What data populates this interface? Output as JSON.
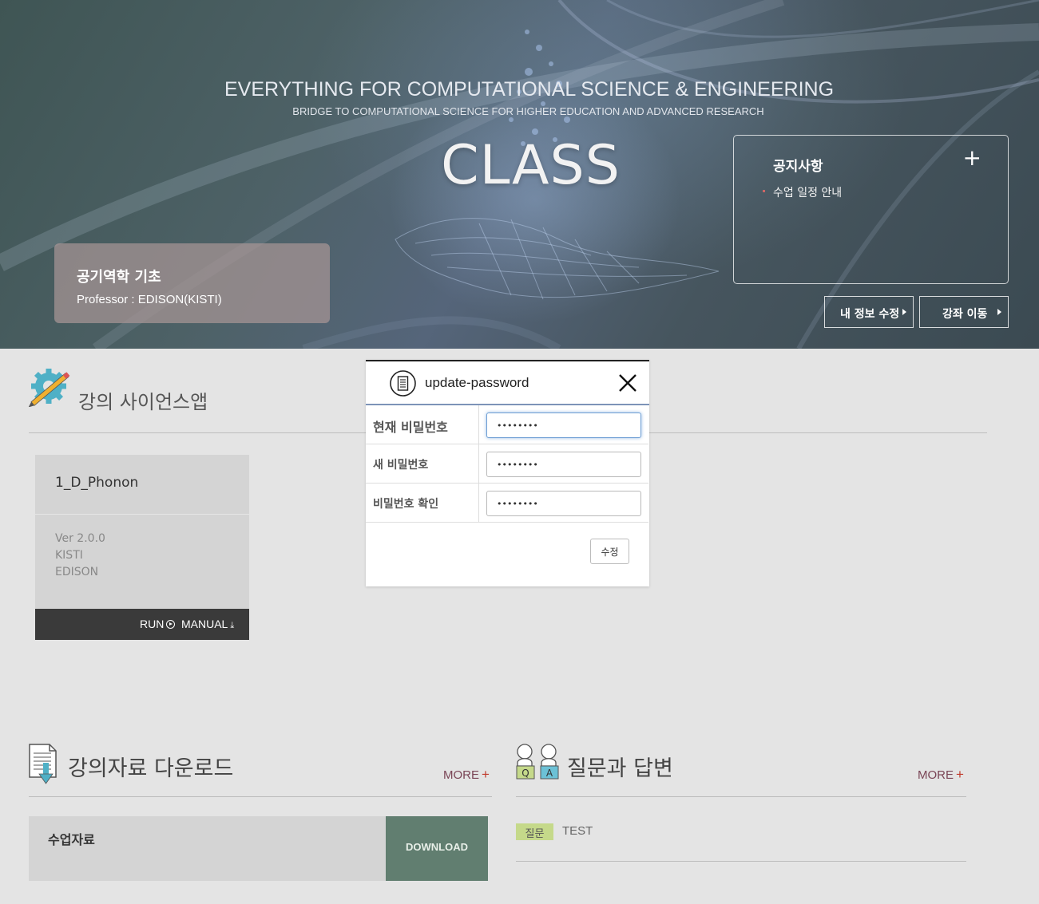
{
  "hero": {
    "headline": "EVERYTHING FOR COMPUTATIONAL SCIENCE & ENGINEERING",
    "subheadline": "BRIDGE TO COMPUTATIONAL SCIENCE FOR HIGHER EDUCATION AND ADVANCED RESEARCH",
    "class_label": "CLASS"
  },
  "course": {
    "title": "공기역학 기초",
    "professor": "Professor : EDISON(KISTI)"
  },
  "notice": {
    "title": "공지사항",
    "plus_icon": "plus-icon",
    "items": [
      "수업 일정 안내"
    ]
  },
  "buttons": {
    "my_info": "내 정보 수정",
    "move_course": "강좌 이동"
  },
  "science_apps": {
    "title": "강의 사이언스앱",
    "icon": "gear-pencil-icon",
    "apps": [
      {
        "name": "1_D_Phonon",
        "version": "Ver 2.0.0",
        "org": "KISTI",
        "author": "EDISON",
        "run_label": "RUN",
        "manual_label": "MANUAL"
      }
    ]
  },
  "downloads": {
    "title": "강의자료 다운로드",
    "more": "MORE",
    "items": [
      {
        "name": "수업자료",
        "action": "DOWNLOAD"
      }
    ]
  },
  "qa": {
    "title": "질문과 답변",
    "more": "MORE",
    "items": [
      {
        "badge": "질문",
        "text": "TEST"
      }
    ]
  },
  "modal": {
    "title": "update-password",
    "fields": [
      {
        "label": "현재 비밀번호",
        "value": "••••••••"
      },
      {
        "label": "새 비밀번호",
        "value": "••••••••"
      },
      {
        "label": "비밀번호 확인",
        "value": "••••••••"
      }
    ],
    "submit": "수정"
  },
  "colors": {
    "download_bg": "#617e70",
    "qa_badge_bg": "#c5d98a",
    "more_link": "#7a4556",
    "modal_accent": "#7d93b8"
  }
}
